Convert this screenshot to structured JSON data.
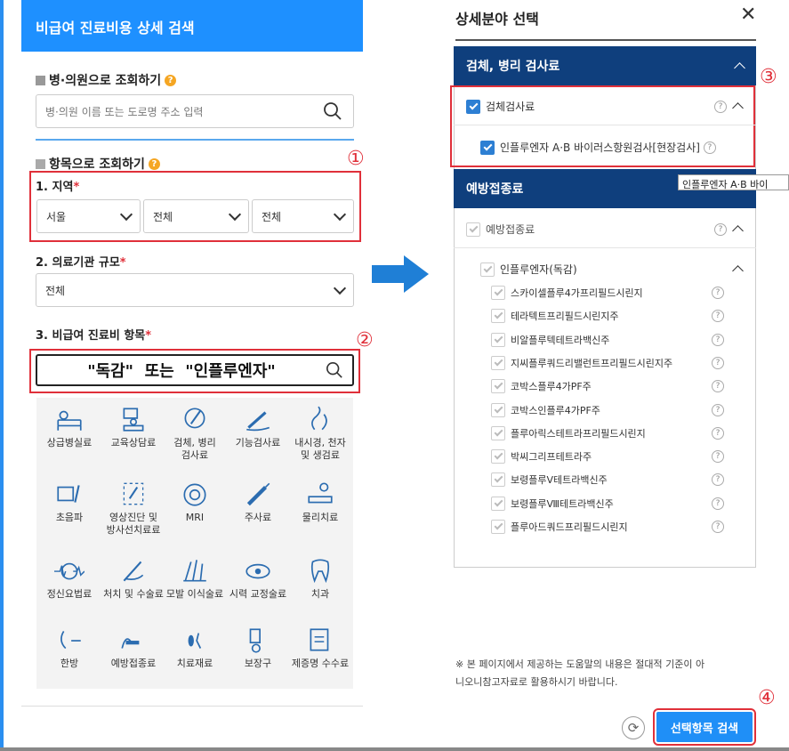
{
  "left": {
    "header": "비급여 진료비용 상세 검색",
    "hospital_section": "병·의원으로 조회하기",
    "hospital_placeholder": "병·의원 이름 또는 도로명 주소 입력",
    "item_section": "항목으로 조회하기",
    "region_label": "1. 지역",
    "region_values": [
      "서울",
      "전체",
      "전체"
    ],
    "scale_label": "2. 의료기관 규모",
    "scale_value": "전체",
    "nonpay_label": "3. 비급여 진료비 항목",
    "search_text": "\"독감\"  또는  \"인플루엔자\"",
    "required_mark": "*",
    "markers": [
      "①",
      "②"
    ],
    "categories": [
      {
        "label": "상급병실료",
        "icon": "bed-icon"
      },
      {
        "label": "교육상담료",
        "icon": "consult-icon"
      },
      {
        "label": "검체, 병리\n검사료",
        "icon": "specimen-icon"
      },
      {
        "label": "기능검사료",
        "icon": "function-test-icon"
      },
      {
        "label": "내시경, 천자\n및 생검료",
        "icon": "endoscope-icon"
      },
      {
        "label": "초음파",
        "icon": "ultrasound-icon"
      },
      {
        "label": "영상진단 및\n방사선치료료",
        "icon": "imaging-icon"
      },
      {
        "label": "MRI",
        "icon": "mri-icon"
      },
      {
        "label": "주사료",
        "icon": "syringe-icon"
      },
      {
        "label": "물리치료",
        "icon": "physio-icon"
      },
      {
        "label": "정신요법료",
        "icon": "brain-icon"
      },
      {
        "label": "처치 및 수술료",
        "icon": "surgery-icon"
      },
      {
        "label": "모발 이식술료",
        "icon": "hair-icon"
      },
      {
        "label": "시력 교정술료",
        "icon": "eye-icon"
      },
      {
        "label": "치과",
        "icon": "tooth-icon"
      },
      {
        "label": "한방",
        "icon": "acupuncture-icon"
      },
      {
        "label": "예방접종료",
        "icon": "vaccine-icon"
      },
      {
        "label": "치료재료",
        "icon": "material-icon"
      },
      {
        "label": "보장구",
        "icon": "wheelchair-icon"
      },
      {
        "label": "제증명 수수료",
        "icon": "certificate-icon"
      }
    ]
  },
  "right": {
    "title": "상세분야 선택",
    "close": "✕",
    "group1": "검체, 병리 검사료",
    "group1_item": "검체검사료",
    "group1_sub": "인플루엔자 A·B 바이러스항원검사[현장검사]",
    "tooltip": "인플루엔자 A·B 바이",
    "group2": "예방접종료",
    "group2_item": "예방접종료",
    "group2_sub": "인플루엔자(독감)",
    "vaccines": [
      "스카이셀플루4가프리필드시린지",
      "테라텍트프리필드시린지주",
      "비알플루텍테트라백신주",
      "지씨플루쿼드리밸런트프리필드시린지주",
      "코박스플루4가PF주",
      "코박스인플루4가PF주",
      "플루아릭스테트라프리필드시린지",
      "박씨그리프테트라주",
      "보령플루V테트라백신주",
      "보령플루Ⅷ테트라백신주",
      "플루아드쿼드프리필드시린지"
    ],
    "notice": [
      "※ 본 페이지에서 제공하는 도움말의 내용은 절대적 기준이 아",
      "니오니참고자료로 활용하시기 바랍니다."
    ],
    "reset_icon": "⟳",
    "search_button": "선택항목 검색",
    "markers": [
      "③",
      "④"
    ],
    "help": "?"
  },
  "colors": {
    "header_blue": "#1e90ff",
    "navy": "#0f3f7d",
    "check_blue": "#2d7fd3",
    "highlight_red": "#e0303a"
  }
}
